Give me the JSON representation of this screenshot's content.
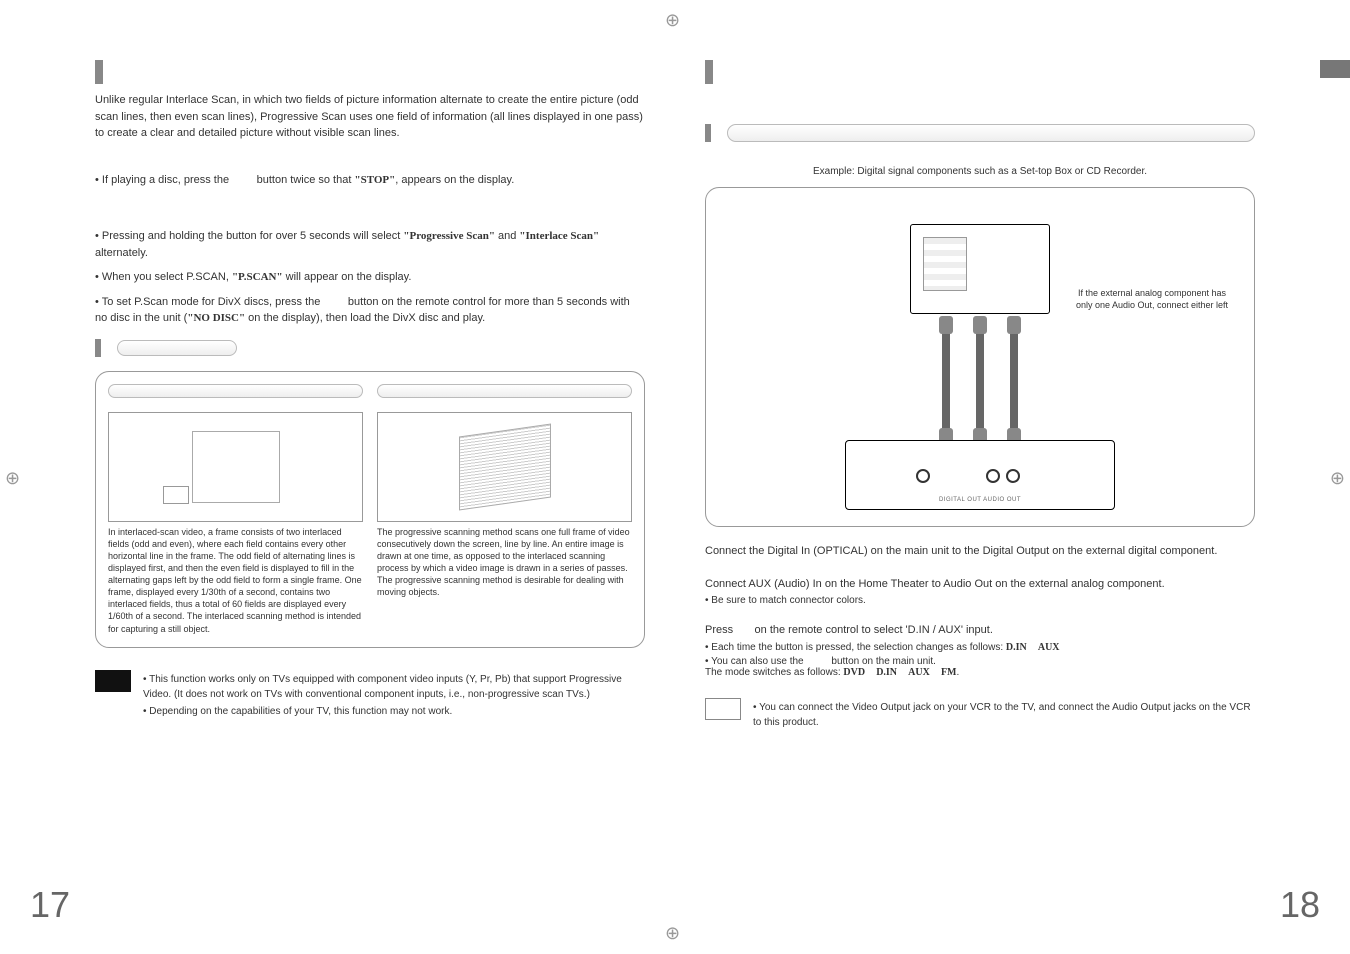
{
  "left": {
    "intro": "Unlike regular Interlace Scan, in which two fields of picture information alternate to create the entire picture (odd scan lines, then even scan lines), Progressive Scan uses one field of information (all lines displayed in one pass) to create a clear and detailed picture without visible scan lines.",
    "step1_a": "If playing a disc, press the",
    "step1_b": "button twice so that",
    "stop": "\"STOP\"",
    "step1_c": ", appears on the display.",
    "b1_a": "Pressing and holding the button for over 5 seconds will select ",
    "b1_ps": "\"Progressive Scan\"",
    "b1_and": " and ",
    "b1_is": "\"Interlace Scan\"",
    "b1_b": " alternately.",
    "b2_a": "When you select P.SCAN, ",
    "b2_p": "\"P.SCAN\"",
    "b2_b": " will appear on the display.",
    "b3_a": "To set P.Scan mode for DivX discs, press the",
    "b3_b": "button on the remote control for more than 5 seconds with no disc in the unit (",
    "b3_nd": "\"NO DISC\"",
    "b3_c": " on the display), then load the DivX disc and play.",
    "interlaced_desc": "In interlaced-scan video, a frame consists of two interlaced fields (odd and even), where each field contains every other horizontal line in the frame. The odd field of alternating lines is displayed first, and then the even field is displayed to fill in the alternating gaps left by the odd field to form a single frame. One frame, displayed every 1/30th of a second, contains two interlaced fields, thus a total of 60 fields are displayed every 1/60th of a second. The interlaced scanning method is intended for capturing a still object.",
    "progressive_desc": "The progressive scanning method scans one full frame of video consecutively down the screen, line by line. An entire image is drawn at one time, as opposed to the interlaced scanning process by which a video image is drawn in a series of passes. The progressive scanning method is desirable for dealing with moving objects.",
    "note1": "This function works only on TVs equipped with component video inputs (Y, Pr, Pb) that support Progressive Video. (It does not work on TVs with conventional component inputs, i.e., non-progressive scan TVs.)",
    "note2": "Depending on the capabilities of your TV, this function may not work.",
    "page_num": "17"
  },
  "right": {
    "example": "Example: Digital signal components such as a Set-top Box or CD Recorder.",
    "callout": "If the external analog component has only one Audio Out, connect either left",
    "step1": "Connect the Digital In (OPTICAL) on the main unit to the Digital Output on the external digital component.",
    "step2": "Connect AUX (Audio) In on the Home Theater to Audio Out on the external analog component.",
    "step2_sub": "Be sure to match connector colors.",
    "step3_a": "Press",
    "step3_b": "on the remote control to select 'D.IN / AUX' input.",
    "s3_sub1_a": "Each time the button is pressed, the selection changes as follows: ",
    "sel_din": "D.IN",
    "sel_aux": "AUX",
    "s3_sub2_a": "You can also use the",
    "s3_sub2_b": "button on the main unit.",
    "s3_sub2_c": "The mode switches as follows: ",
    "sel_dvd": "DVD",
    "sel_fm": "FM",
    "note": "You can connect the Video Output jack on your VCR to the TV, and connect the Audio Output jacks on the VCR to this product.",
    "page_num": "18"
  }
}
